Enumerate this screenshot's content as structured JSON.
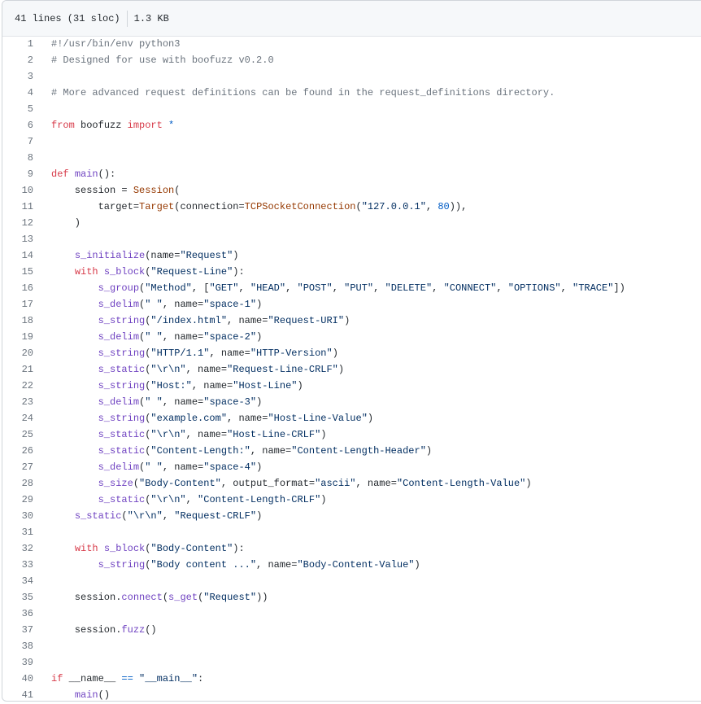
{
  "header": {
    "lines": "41 lines (31 sloc)",
    "size": "1.3 KB"
  },
  "code": [
    [
      [
        "c",
        "#!/usr/bin/env python3"
      ]
    ],
    [
      [
        "c",
        "# Designed for use with boofuzz v0.2.0"
      ]
    ],
    [],
    [
      [
        "c",
        "# More advanced request definitions can be found in the request_definitions directory."
      ]
    ],
    [],
    [
      [
        "k",
        "from"
      ],
      [
        "p",
        " boofuzz "
      ],
      [
        "k",
        "import"
      ],
      [
        "p",
        " "
      ],
      [
        "d",
        "*"
      ]
    ],
    [],
    [],
    [
      [
        "k",
        "def"
      ],
      [
        "p",
        " "
      ],
      [
        "f",
        "main"
      ],
      [
        "p",
        "():"
      ]
    ],
    [
      [
        "p",
        "    session = "
      ],
      [
        "n",
        "Session"
      ],
      [
        "p",
        "("
      ]
    ],
    [
      [
        "p",
        "        target="
      ],
      [
        "n",
        "Target"
      ],
      [
        "p",
        "(connection="
      ],
      [
        "n",
        "TCPSocketConnection"
      ],
      [
        "p",
        "("
      ],
      [
        "s",
        "\"127.0.0.1\""
      ],
      [
        "p",
        ", "
      ],
      [
        "d",
        "80"
      ],
      [
        "p",
        ")),"
      ]
    ],
    [
      [
        "p",
        "    )"
      ]
    ],
    [],
    [
      [
        "p",
        "    "
      ],
      [
        "f",
        "s_initialize"
      ],
      [
        "p",
        "(name="
      ],
      [
        "s",
        "\"Request\""
      ],
      [
        "p",
        ")"
      ]
    ],
    [
      [
        "p",
        "    "
      ],
      [
        "k",
        "with"
      ],
      [
        "p",
        " "
      ],
      [
        "f",
        "s_block"
      ],
      [
        "p",
        "("
      ],
      [
        "s",
        "\"Request-Line\""
      ],
      [
        "p",
        "):"
      ]
    ],
    [
      [
        "p",
        "        "
      ],
      [
        "f",
        "s_group"
      ],
      [
        "p",
        "("
      ],
      [
        "s",
        "\"Method\""
      ],
      [
        "p",
        ", ["
      ],
      [
        "s",
        "\"GET\""
      ],
      [
        "p",
        ", "
      ],
      [
        "s",
        "\"HEAD\""
      ],
      [
        "p",
        ", "
      ],
      [
        "s",
        "\"POST\""
      ],
      [
        "p",
        ", "
      ],
      [
        "s",
        "\"PUT\""
      ],
      [
        "p",
        ", "
      ],
      [
        "s",
        "\"DELETE\""
      ],
      [
        "p",
        ", "
      ],
      [
        "s",
        "\"CONNECT\""
      ],
      [
        "p",
        ", "
      ],
      [
        "s",
        "\"OPTIONS\""
      ],
      [
        "p",
        ", "
      ],
      [
        "s",
        "\"TRACE\""
      ],
      [
        "p",
        "])"
      ]
    ],
    [
      [
        "p",
        "        "
      ],
      [
        "f",
        "s_delim"
      ],
      [
        "p",
        "("
      ],
      [
        "s",
        "\" \""
      ],
      [
        "p",
        ", name="
      ],
      [
        "s",
        "\"space-1\""
      ],
      [
        "p",
        ")"
      ]
    ],
    [
      [
        "p",
        "        "
      ],
      [
        "f",
        "s_string"
      ],
      [
        "p",
        "("
      ],
      [
        "s",
        "\"/index.html\""
      ],
      [
        "p",
        ", name="
      ],
      [
        "s",
        "\"Request-URI\""
      ],
      [
        "p",
        ")"
      ]
    ],
    [
      [
        "p",
        "        "
      ],
      [
        "f",
        "s_delim"
      ],
      [
        "p",
        "("
      ],
      [
        "s",
        "\" \""
      ],
      [
        "p",
        ", name="
      ],
      [
        "s",
        "\"space-2\""
      ],
      [
        "p",
        ")"
      ]
    ],
    [
      [
        "p",
        "        "
      ],
      [
        "f",
        "s_string"
      ],
      [
        "p",
        "("
      ],
      [
        "s",
        "\"HTTP/1.1\""
      ],
      [
        "p",
        ", name="
      ],
      [
        "s",
        "\"HTTP-Version\""
      ],
      [
        "p",
        ")"
      ]
    ],
    [
      [
        "p",
        "        "
      ],
      [
        "f",
        "s_static"
      ],
      [
        "p",
        "("
      ],
      [
        "s",
        "\"\\r\\n\""
      ],
      [
        "p",
        ", name="
      ],
      [
        "s",
        "\"Request-Line-CRLF\""
      ],
      [
        "p",
        ")"
      ]
    ],
    [
      [
        "p",
        "        "
      ],
      [
        "f",
        "s_string"
      ],
      [
        "p",
        "("
      ],
      [
        "s",
        "\"Host:\""
      ],
      [
        "p",
        ", name="
      ],
      [
        "s",
        "\"Host-Line\""
      ],
      [
        "p",
        ")"
      ]
    ],
    [
      [
        "p",
        "        "
      ],
      [
        "f",
        "s_delim"
      ],
      [
        "p",
        "("
      ],
      [
        "s",
        "\" \""
      ],
      [
        "p",
        ", name="
      ],
      [
        "s",
        "\"space-3\""
      ],
      [
        "p",
        ")"
      ]
    ],
    [
      [
        "p",
        "        "
      ],
      [
        "f",
        "s_string"
      ],
      [
        "p",
        "("
      ],
      [
        "s",
        "\"example.com\""
      ],
      [
        "p",
        ", name="
      ],
      [
        "s",
        "\"Host-Line-Value\""
      ],
      [
        "p",
        ")"
      ]
    ],
    [
      [
        "p",
        "        "
      ],
      [
        "f",
        "s_static"
      ],
      [
        "p",
        "("
      ],
      [
        "s",
        "\"\\r\\n\""
      ],
      [
        "p",
        ", name="
      ],
      [
        "s",
        "\"Host-Line-CRLF\""
      ],
      [
        "p",
        ")"
      ]
    ],
    [
      [
        "p",
        "        "
      ],
      [
        "f",
        "s_static"
      ],
      [
        "p",
        "("
      ],
      [
        "s",
        "\"Content-Length:\""
      ],
      [
        "p",
        ", name="
      ],
      [
        "s",
        "\"Content-Length-Header\""
      ],
      [
        "p",
        ")"
      ]
    ],
    [
      [
        "p",
        "        "
      ],
      [
        "f",
        "s_delim"
      ],
      [
        "p",
        "("
      ],
      [
        "s",
        "\" \""
      ],
      [
        "p",
        ", name="
      ],
      [
        "s",
        "\"space-4\""
      ],
      [
        "p",
        ")"
      ]
    ],
    [
      [
        "p",
        "        "
      ],
      [
        "f",
        "s_size"
      ],
      [
        "p",
        "("
      ],
      [
        "s",
        "\"Body-Content\""
      ],
      [
        "p",
        ", output_format="
      ],
      [
        "s",
        "\"ascii\""
      ],
      [
        "p",
        ", name="
      ],
      [
        "s",
        "\"Content-Length-Value\""
      ],
      [
        "p",
        ")"
      ]
    ],
    [
      [
        "p",
        "        "
      ],
      [
        "f",
        "s_static"
      ],
      [
        "p",
        "("
      ],
      [
        "s",
        "\"\\r\\n\""
      ],
      [
        "p",
        ", "
      ],
      [
        "s",
        "\"Content-Length-CRLF\""
      ],
      [
        "p",
        ")"
      ]
    ],
    [
      [
        "p",
        "    "
      ],
      [
        "f",
        "s_static"
      ],
      [
        "p",
        "("
      ],
      [
        "s",
        "\"\\r\\n\""
      ],
      [
        "p",
        ", "
      ],
      [
        "s",
        "\"Request-CRLF\""
      ],
      [
        "p",
        ")"
      ]
    ],
    [],
    [
      [
        "p",
        "    "
      ],
      [
        "k",
        "with"
      ],
      [
        "p",
        " "
      ],
      [
        "f",
        "s_block"
      ],
      [
        "p",
        "("
      ],
      [
        "s",
        "\"Body-Content\""
      ],
      [
        "p",
        "):"
      ]
    ],
    [
      [
        "p",
        "        "
      ],
      [
        "f",
        "s_string"
      ],
      [
        "p",
        "("
      ],
      [
        "s",
        "\"Body content ...\""
      ],
      [
        "p",
        ", name="
      ],
      [
        "s",
        "\"Body-Content-Value\""
      ],
      [
        "p",
        ")"
      ]
    ],
    [],
    [
      [
        "p",
        "    session."
      ],
      [
        "f",
        "connect"
      ],
      [
        "p",
        "("
      ],
      [
        "f",
        "s_get"
      ],
      [
        "p",
        "("
      ],
      [
        "s",
        "\"Request\""
      ],
      [
        "p",
        "))"
      ]
    ],
    [],
    [
      [
        "p",
        "    session."
      ],
      [
        "f",
        "fuzz"
      ],
      [
        "p",
        "()"
      ]
    ],
    [],
    [],
    [
      [
        "k",
        "if"
      ],
      [
        "p",
        " __name__ "
      ],
      [
        "d",
        "=="
      ],
      [
        "p",
        " "
      ],
      [
        "s",
        "\"__main__\""
      ],
      [
        "p",
        ":"
      ]
    ],
    [
      [
        "p",
        "    "
      ],
      [
        "f",
        "main"
      ],
      [
        "p",
        "()"
      ]
    ]
  ]
}
